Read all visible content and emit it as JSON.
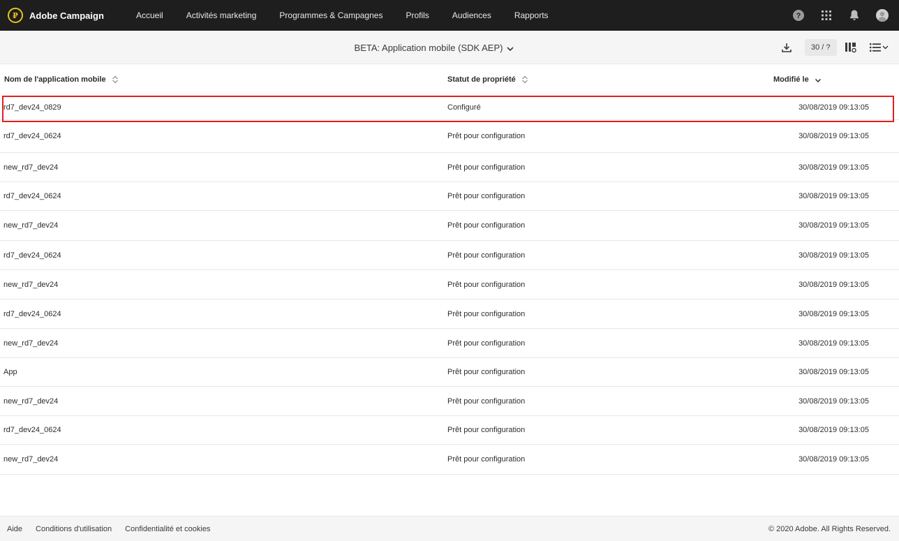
{
  "brand": {
    "name": "Adobe Campaign",
    "logo_glyph": "₽"
  },
  "nav": {
    "items": [
      {
        "label": "Accueil"
      },
      {
        "label": "Activités marketing"
      },
      {
        "label": "Programmes & Campagnes"
      },
      {
        "label": "Profils"
      },
      {
        "label": "Audiences"
      },
      {
        "label": "Rapports"
      }
    ],
    "icons": [
      "help-icon",
      "apps-grid-icon",
      "notifications-bell-icon",
      "user-avatar-icon"
    ]
  },
  "toolbar": {
    "title": "BETA: Application mobile (SDK AEP)",
    "count": "30 / ?",
    "icons": [
      "download-icon",
      "column-settings-icon",
      "list-view-icon"
    ]
  },
  "table": {
    "columns": [
      {
        "label": "Nom de l'application mobile"
      },
      {
        "label": "Statut de propriété"
      },
      {
        "label": "Modifié le"
      }
    ],
    "rows": [
      {
        "name": "rd7_dev24_0829",
        "status": "Configuré",
        "modified": "30/08/2019 09:13:05",
        "selected": true
      },
      {
        "name": "rd7_dev24_0624",
        "status": "Prêt pour configuration",
        "modified": "30/08/2019 09:13:05"
      },
      {
        "name": "new_rd7_dev24",
        "status": "Prêt pour configuration",
        "modified": "30/08/2019 09:13:05"
      },
      {
        "name": "rd7_dev24_0624",
        "status": "Prêt pour configuration",
        "modified": "30/08/2019 09:13:05"
      },
      {
        "name": "new_rd7_dev24",
        "status": "Prêt pour configuration",
        "modified": "30/08/2019 09:13:05"
      },
      {
        "name": "rd7_dev24_0624",
        "status": "Prêt pour configuration",
        "modified": "30/08/2019 09:13:05"
      },
      {
        "name": "new_rd7_dev24",
        "status": "Prêt pour configuration",
        "modified": "30/08/2019 09:13:05"
      },
      {
        "name": "rd7_dev24_0624",
        "status": "Prêt pour configuration",
        "modified": "30/08/2019 09:13:05"
      },
      {
        "name": "new_rd7_dev24",
        "status": "Prêt pour configuration",
        "modified": "30/08/2019 09:13:05"
      },
      {
        "name": "App",
        "status": "Prêt pour configuration",
        "modified": "30/08/2019 09:13:05"
      },
      {
        "name": "new_rd7_dev24",
        "status": "Prêt pour configuration",
        "modified": "30/08/2019 09:13:05"
      },
      {
        "name": "rd7_dev24_0624",
        "status": "Prêt pour configuration",
        "modified": "30/08/2019 09:13:05"
      },
      {
        "name": "new_rd7_dev24",
        "status": "Prêt pour configuration",
        "modified": "30/08/2019 09:13:05"
      }
    ]
  },
  "footer": {
    "links": [
      {
        "label": "Aide"
      },
      {
        "label": "Conditions d'utilisation"
      },
      {
        "label": "Confidentialité et cookies"
      }
    ],
    "copyright": "© 2020 Adobe. All Rights Reserved."
  },
  "colors": {
    "nav_bg": "#1e1e1e",
    "brand_accent": "#e6c619",
    "selection_outline": "#e02020"
  }
}
